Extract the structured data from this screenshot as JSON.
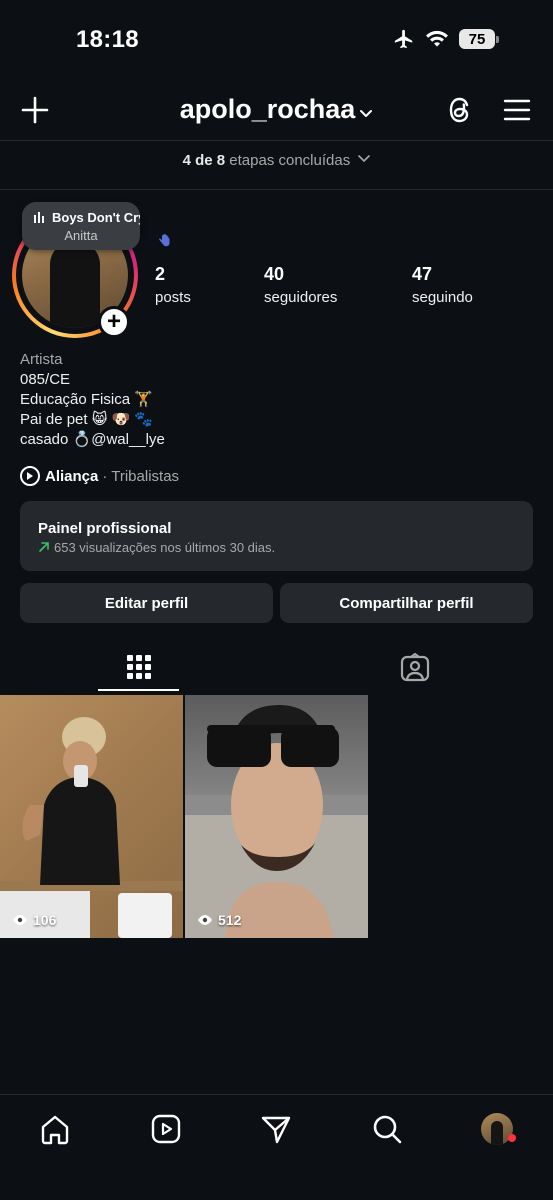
{
  "status_bar": {
    "time": "18:18",
    "battery": "75"
  },
  "header": {
    "username": "apolo_rochaa"
  },
  "onboarding": {
    "done": "4 de 8",
    "text": "etapas concluídas"
  },
  "note": {
    "song_title": "Boys Don't Cry",
    "artist": "Anitta"
  },
  "stats": [
    {
      "value": "2",
      "label": "posts"
    },
    {
      "value": "40",
      "label": "seguidores"
    },
    {
      "value": "47",
      "label": "seguindo"
    }
  ],
  "bio": {
    "category": "Artista",
    "lines": [
      "085/CE",
      "Educação Fisica 🏋️",
      "Pai de pet 😸 🐶 🐾",
      "casado 💍@wal__lye"
    ]
  },
  "profile_song": {
    "title": "Aliança",
    "artist": "· Tribalistas"
  },
  "dashboard": {
    "title": "Painel profissional",
    "subtitle": "653 visualizações nos últimos 30 dias."
  },
  "buttons": {
    "edit": "Editar perfil",
    "share": "Compartilhar perfil"
  },
  "posts": [
    {
      "views": "106"
    },
    {
      "views": "512"
    }
  ],
  "colors": {
    "background": "#0c1014",
    "panel": "#25292e",
    "trend_green": "#3fbf5f",
    "notification_red": "#ff3040"
  },
  "icons": {
    "header": [
      "plus-icon",
      "chevron-down-icon",
      "threads-icon",
      "menu-icon"
    ],
    "tabs": [
      "grid-icon",
      "tagged-icon"
    ],
    "nav": [
      "home-icon",
      "reels-icon",
      "send-icon",
      "search-icon",
      "profile-avatar"
    ]
  }
}
